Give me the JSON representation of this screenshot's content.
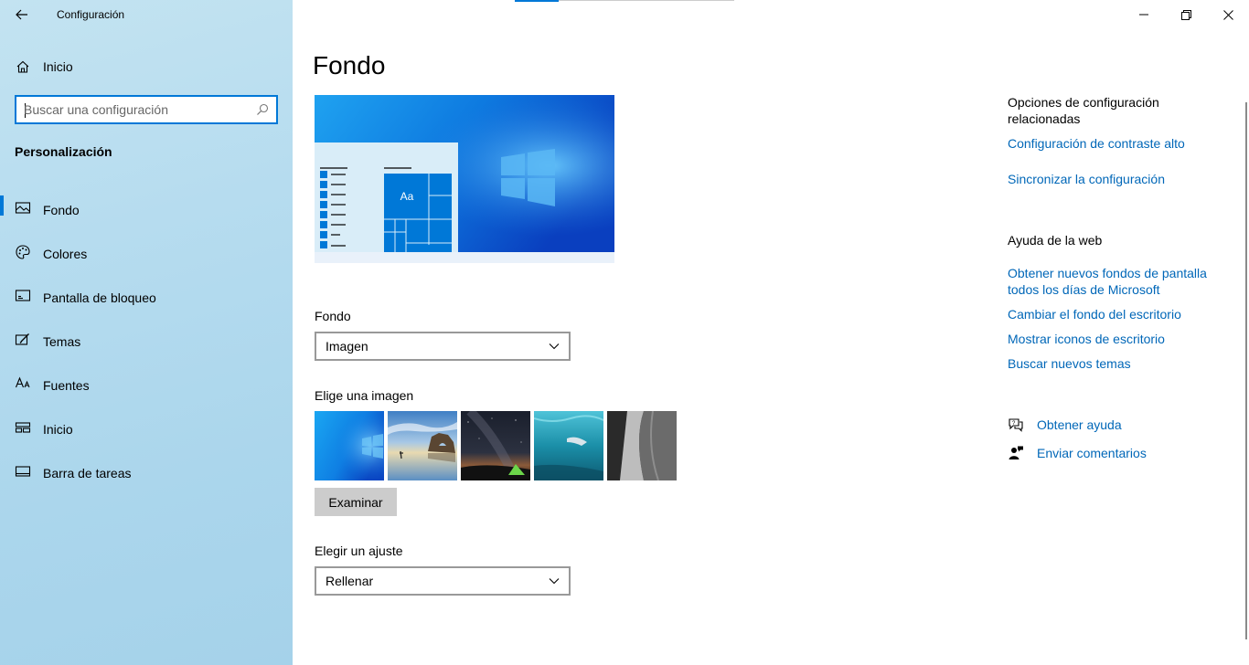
{
  "window": {
    "title": "Configuración"
  },
  "sidebar": {
    "home_label": "Inicio",
    "search_placeholder": "Buscar una configuración",
    "section_title": "Personalización",
    "items": [
      {
        "label": "Fondo",
        "icon": "picture-icon",
        "active": true
      },
      {
        "label": "Colores",
        "icon": "palette-icon",
        "active": false
      },
      {
        "label": "Pantalla de bloqueo",
        "icon": "lock-screen-icon",
        "active": false
      },
      {
        "label": "Temas",
        "icon": "themes-brush-icon",
        "active": false
      },
      {
        "label": "Fuentes",
        "icon": "fonts-icon",
        "active": false
      },
      {
        "label": "Inicio",
        "icon": "start-layout-icon",
        "active": false
      },
      {
        "label": "Barra de tareas",
        "icon": "taskbar-icon",
        "active": false
      }
    ]
  },
  "main": {
    "title": "Fondo",
    "preview": {
      "tile_text": "Aa"
    },
    "background_label": "Fondo",
    "background_value": "Imagen",
    "choose_image_label": "Elige una imagen",
    "thumbnails": [
      "windows-blue-wallpaper",
      "beach-rock-arch",
      "night-sky-tent",
      "underwater-swimmer",
      "rock-cliff"
    ],
    "browse_label": "Examinar",
    "fit_label": "Elegir un ajuste",
    "fit_value": "Rellenar"
  },
  "right_panel": {
    "related_heading": "Opciones de configuración relacionadas",
    "related_links": [
      "Configuración de contraste alto",
      "Sincronizar la configuración"
    ],
    "web_help_heading": "Ayuda de la web",
    "web_help_links": [
      "Obtener nuevos fondos de pantalla todos los días de Microsoft",
      "Cambiar el fondo del escritorio",
      "Mostrar iconos de escritorio",
      "Buscar nuevos temas"
    ],
    "get_help": "Obtener ayuda",
    "feedback": "Enviar comentarios"
  },
  "colors": {
    "accent": "#0078d7",
    "link": "#0067b8",
    "sidebar_bg": "#b6dcef"
  }
}
